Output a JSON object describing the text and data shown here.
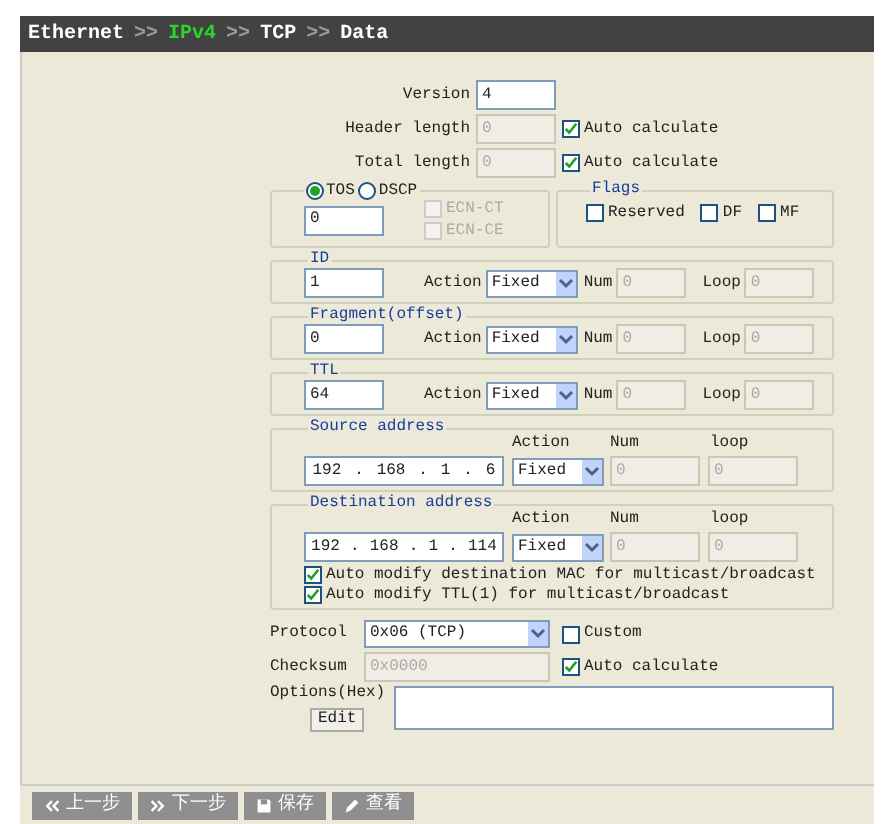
{
  "breadcrumb": [
    {
      "label": "Ethernet",
      "selected": false
    },
    {
      "label": "IPv4",
      "selected": true
    },
    {
      "label": "TCP",
      "selected": false
    },
    {
      "label": "Data",
      "selected": false
    }
  ],
  "separator": ">>",
  "top_fields": [
    {
      "label": "Version",
      "value": "4",
      "disabled": false
    },
    {
      "label": "Header length",
      "value": "0",
      "disabled": true,
      "checkbox": {
        "label": "Auto calculate",
        "checked": true
      }
    },
    {
      "label": "Total length",
      "value": "0",
      "disabled": true,
      "checkbox": {
        "label": "Auto calculate",
        "checked": true
      }
    }
  ],
  "tos": {
    "radios": [
      {
        "label": "TOS",
        "selected": true
      },
      {
        "label": "DSCP",
        "selected": false
      }
    ],
    "value": "0",
    "checks": [
      {
        "label": "ECN-CT",
        "checked": false,
        "disabled": true
      },
      {
        "label": "ECN-CE",
        "checked": false,
        "disabled": true
      }
    ]
  },
  "flags": {
    "title": "Flags",
    "checks": [
      {
        "label": "Reserved",
        "checked": false
      },
      {
        "label": "DF",
        "checked": false
      },
      {
        "label": "MF",
        "checked": false
      }
    ]
  },
  "action_groups": [
    {
      "title": "ID",
      "value": "1",
      "action_label": "Action",
      "action": "Fixed",
      "num_label": "Num",
      "num": "0",
      "loop_label": "Loop",
      "loop": "0"
    },
    {
      "title": "Fragment(offset)",
      "value": "0",
      "action_label": "Action",
      "action": "Fixed",
      "num_label": "Num",
      "num": "0",
      "loop_label": "Loop",
      "loop": "0"
    },
    {
      "title": "TTL",
      "value": "64",
      "action_label": "Action",
      "action": "Fixed",
      "num_label": "Num",
      "num": "0",
      "loop_label": "Loop",
      "loop": "0"
    }
  ],
  "address_groups": [
    {
      "title": "Source address",
      "ip": [
        "192",
        ".",
        "168",
        ".",
        "1",
        ".",
        "6"
      ],
      "action_label": "Action",
      "action": "Fixed",
      "num_label": "Num",
      "num": "0",
      "loop_label": "loop",
      "loop": "0"
    },
    {
      "title": "Destination address",
      "ip": [
        "192",
        ".",
        "168",
        ".",
        "1",
        ".",
        "114"
      ],
      "action_label": "Action",
      "action": "Fixed",
      "num_label": "Num",
      "num": "0",
      "loop_label": "loop",
      "loop": "0",
      "checks": [
        {
          "label": "Auto modify destination MAC for multicast/broadcast",
          "checked": true
        },
        {
          "label": "Auto modify TTL(1) for multicast/broadcast",
          "checked": true
        }
      ]
    }
  ],
  "protocol": {
    "label": "Protocol",
    "value": "0x06 (TCP)",
    "custom": {
      "label": "Custom",
      "checked": false
    }
  },
  "checksum": {
    "label": "Checksum",
    "value": "0x0000",
    "auto": {
      "label": "Auto calculate",
      "checked": true
    }
  },
  "options": {
    "label": "Options(Hex)",
    "edit": "Edit"
  },
  "buttons": [
    {
      "label": "上一步"
    },
    {
      "label": "下一步"
    },
    {
      "label": "保存"
    },
    {
      "label": "查看"
    }
  ]
}
